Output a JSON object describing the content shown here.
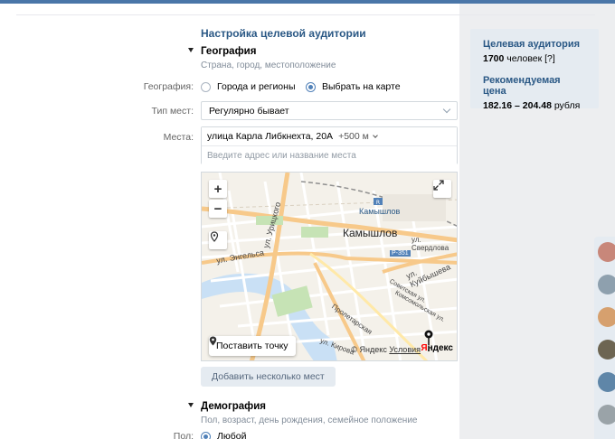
{
  "header": {
    "title": "Настройка целевой аудитории"
  },
  "geo": {
    "title": "География",
    "subtitle": "Страна, город, местоположение",
    "geo_label": "География:",
    "radio_cities": "Города и регионы",
    "radio_map": "Выбрать на карте",
    "place_type_label": "Тип мест:",
    "place_type_value": "Регулярно бывает",
    "places_label": "Места:",
    "place_tag": "улица Карла Либкнехта, 20А",
    "place_radius": "+500 м",
    "address_placeholder": "Введите адрес или название места",
    "add_places_button": "Добавить несколько мест"
  },
  "map": {
    "city": "Камышлов",
    "station": "Камышлов",
    "streets": [
      "ул. Урицкого",
      "ул. Энгельса",
      "ул. Свердлова",
      "ул. Куйбышева",
      "Пролетарская",
      "ул. Кирова",
      "Советская ул.",
      "Комсомольская ул.",
      "Р-351"
    ],
    "zoom_in": "+",
    "zoom_out": "−",
    "set_point_button": "Поставить точку",
    "copyright": "© Яндекс",
    "terms_link": "Условия",
    "logo_y": "Я",
    "logo_rest": "ндекс"
  },
  "demo": {
    "title": "Демография",
    "subtitle": "Пол, возраст, день рождения, семейное положение",
    "gender_label": "Пол:",
    "gender_value": "Любой"
  },
  "side": {
    "audience_title": "Целевая аудитория",
    "audience_count": "1700",
    "audience_unit": "человек [?]",
    "price_title": "Рекомендуемая цена",
    "price_range": "182.16 – 204.48",
    "price_unit": "рубля"
  },
  "colors": {
    "accent": "#2a5885",
    "brand": "#4a76a8",
    "radio_on": "#5181b8"
  }
}
